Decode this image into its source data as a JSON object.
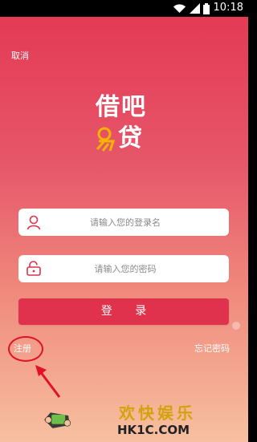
{
  "status_bar": {
    "time": "10:18"
  },
  "header": {
    "cancel_label": "取消"
  },
  "logo": {
    "line1": "借吧",
    "line2": "贷"
  },
  "form": {
    "username_placeholder": "请输入您的登录名",
    "password_placeholder": "请输入您的密码"
  },
  "actions": {
    "login_label": "登 录",
    "register_label": "注册",
    "forgot_label": "忘记密码"
  },
  "watermark": {
    "title": "欢快娱乐",
    "site": "HK1C.COM"
  },
  "colors": {
    "gradient_top": "#e43a55",
    "gradient_bottom": "#f7c0a0",
    "button": "#e0324c",
    "annotation": "#e3102a",
    "logo_accent": "#f5b400"
  }
}
